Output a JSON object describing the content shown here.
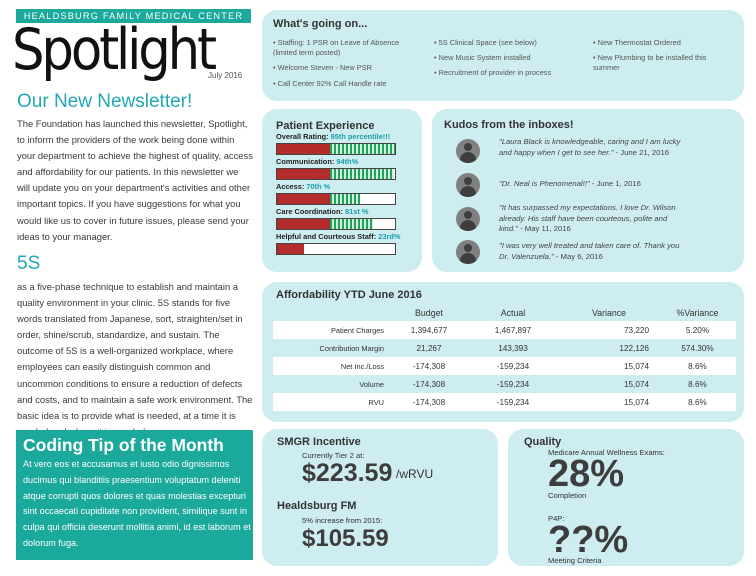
{
  "masthead": {
    "org": "HEALDSBURG FAMILY MEDICAL CENTER",
    "title": "Spotlight",
    "date": "July 2016"
  },
  "newsletter": {
    "heading": "Our New Newsletter!",
    "body": "The Foundation has launched this newsletter, Spotlight, to inform the providers of the work being done within your department to achieve the highest of quality, access and affordability for our patients. In this newsletter we will update you on your department's activities and other important topics. If you have suggestions for what you would like us to cover in future issues, please send your ideas to your manager."
  },
  "fives": {
    "heading": "5S",
    "body": "as a five-phase technique to establish and maintain a quality environment in your clinic. 5S stands for five words translated from Japanese, sort, straighten/set in order, shine/scrub, standardize, and sustain. The outcome of 5S is a well-organized workplace, where employees can easily distinguish common and uncommon conditions to ensure a reduction of defects and costs, and to maintain a safe work environment. The basic idea is to provide what is needed, at a time it is needed and where it is needed."
  },
  "coding": {
    "title": "Coding Tip of the Month",
    "body": "At vero eos et accusamus et iusto odio dignissimos ducimus qui blanditiis praesentium voluptatum deleniti atque corrupti quos dolores et quas molestias excepturi sint occaecati cupiditate non provident, similique sunt in culpa qui officia deserunt mollitia animi, id est laborum et dolorum fuga."
  },
  "whats_going_on": {
    "title": "What's going on...",
    "col1": [
      "• Staffing: 1 PSR on Leave of Absence (limited term posted)",
      "• Welcome Steven - New PSR",
      "• Call Center 92% Call Handle rate"
    ],
    "col2": [
      "• 5S Clinical Space (see below)",
      "• New Music System installed",
      "• Recruitment of provider in process"
    ],
    "col3": [
      "• New Thermostat Ordered",
      "• New Plumbing to be installed this summer"
    ]
  },
  "patient_experience": {
    "title": "Patient Experience",
    "metrics": [
      {
        "label": "Overall Rating:",
        "value": "95th percentile!!!",
        "red": 0.45,
        "green": 0.55
      },
      {
        "label": "Communication:",
        "value": "94th%",
        "red": 0.45,
        "green": 0.54
      },
      {
        "label": "Access:",
        "value": "70th %",
        "red": 0.45,
        "green": 0.25
      },
      {
        "label": "Care Coordination:",
        "value": "81st %",
        "red": 0.45,
        "green": 0.36
      },
      {
        "label": "Helpful and Courteous Staff:",
        "value": "23rd%",
        "red": 0.23,
        "green": 0
      }
    ],
    "colors": {
      "red": "#b42b2b",
      "green": "#1fa45b",
      "value": "#1a9db0"
    }
  },
  "kudos": {
    "title": "Kudos from the inboxes!",
    "items": [
      {
        "quote": "\"Laura Black is knowledgeable, caring and I am lucky and happy when I get to see her.\"",
        "date": "- June 21, 2016"
      },
      {
        "quote": "\"Dr. Neal is Phenomenal!!\"",
        "date": "- June 1, 2016"
      },
      {
        "quote": "\"It has surpassed my expectations. I love Dr. Wilson already. His staff have been courteous, polite and kind.\"",
        "date": "- May 11, 2016"
      },
      {
        "quote": "\"I was very well treated and taken care of. Thank you Dr. Valenzuela.\"",
        "date": "- May 6, 2016"
      }
    ]
  },
  "affordability": {
    "title": "Affordability YTD June 2016",
    "headers": [
      "Budget",
      "Actual",
      "Variance",
      "%Variance"
    ],
    "rows": [
      {
        "label": "Patient Charges",
        "budget": "1,394,677",
        "actual": "1,467,897",
        "variance": "73,220",
        "pct": "5.20%"
      },
      {
        "label": "Contribution Margin",
        "budget": "21,267",
        "actual": "143,393",
        "variance": "122,126",
        "pct": "574.30%"
      },
      {
        "label": "Net Inc./Loss",
        "budget": "-174,308",
        "actual": "-159,234",
        "variance": "15,074",
        "pct": "8.6%"
      },
      {
        "label": "Volume",
        "budget": "-174,308",
        "actual": "-159,234",
        "variance": "15,074",
        "pct": "8.6%"
      },
      {
        "label": "RVU",
        "budget": "-174,308",
        "actual": "-159,234",
        "variance": "15,074",
        "pct": "8.6%"
      }
    ]
  },
  "smgr": {
    "title": "SMGR Incentive",
    "sub": "Currently Tier 2 at:",
    "amount": "$223.59",
    "unit": "/wRVU"
  },
  "hfm": {
    "title": "Healdsburg FM",
    "sub": "5% increase from 2015:",
    "amount": "$105.59"
  },
  "quality": {
    "title": "Quality",
    "label1": "Medicare Annual Wellness Exams:",
    "value1": "28%",
    "caption1": "Completion",
    "label2": "P4P:",
    "value2": "??%",
    "caption2": "Meeting Criteria"
  },
  "colors": {
    "teal": "#1ba99b",
    "panel": "#ceedf0",
    "heading_blue": "#22a7b5"
  }
}
